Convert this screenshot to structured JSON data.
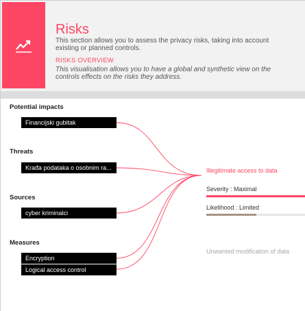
{
  "header": {
    "title": "Risks",
    "description": "This section allows you to assess the privacy risks, taking into account existing or planned controls.",
    "subtitle": "RISKS OVERVIEW",
    "subdescription": "This visualisation allows you to have a global and synthetic view on the controls effects on the risks they address.",
    "icon": "trending-up-icon",
    "accent_color": "#fd4664"
  },
  "sections": {
    "impacts": {
      "label": "Potential impacts",
      "items": [
        "Financijski gubitak"
      ]
    },
    "threats": {
      "label": "Threats",
      "items": [
        "Krađa podataka o osobnim ra..."
      ]
    },
    "sources": {
      "label": "Sources",
      "items": [
        "cyber kriminalci"
      ]
    },
    "measures": {
      "label": "Measures",
      "items": [
        "Encryption",
        "Logical access control"
      ]
    }
  },
  "risks": {
    "active": {
      "title": "Illegitimate access to data",
      "severity_label": "Severity : Maximal",
      "severity_level": 1.0,
      "severity_color": "#fd4664",
      "likelihood_label": "Likelihood : Limited",
      "likelihood_level": 0.5,
      "likelihood_color": "#a79482"
    },
    "secondary": {
      "title": "Unwanted modification of data"
    }
  }
}
